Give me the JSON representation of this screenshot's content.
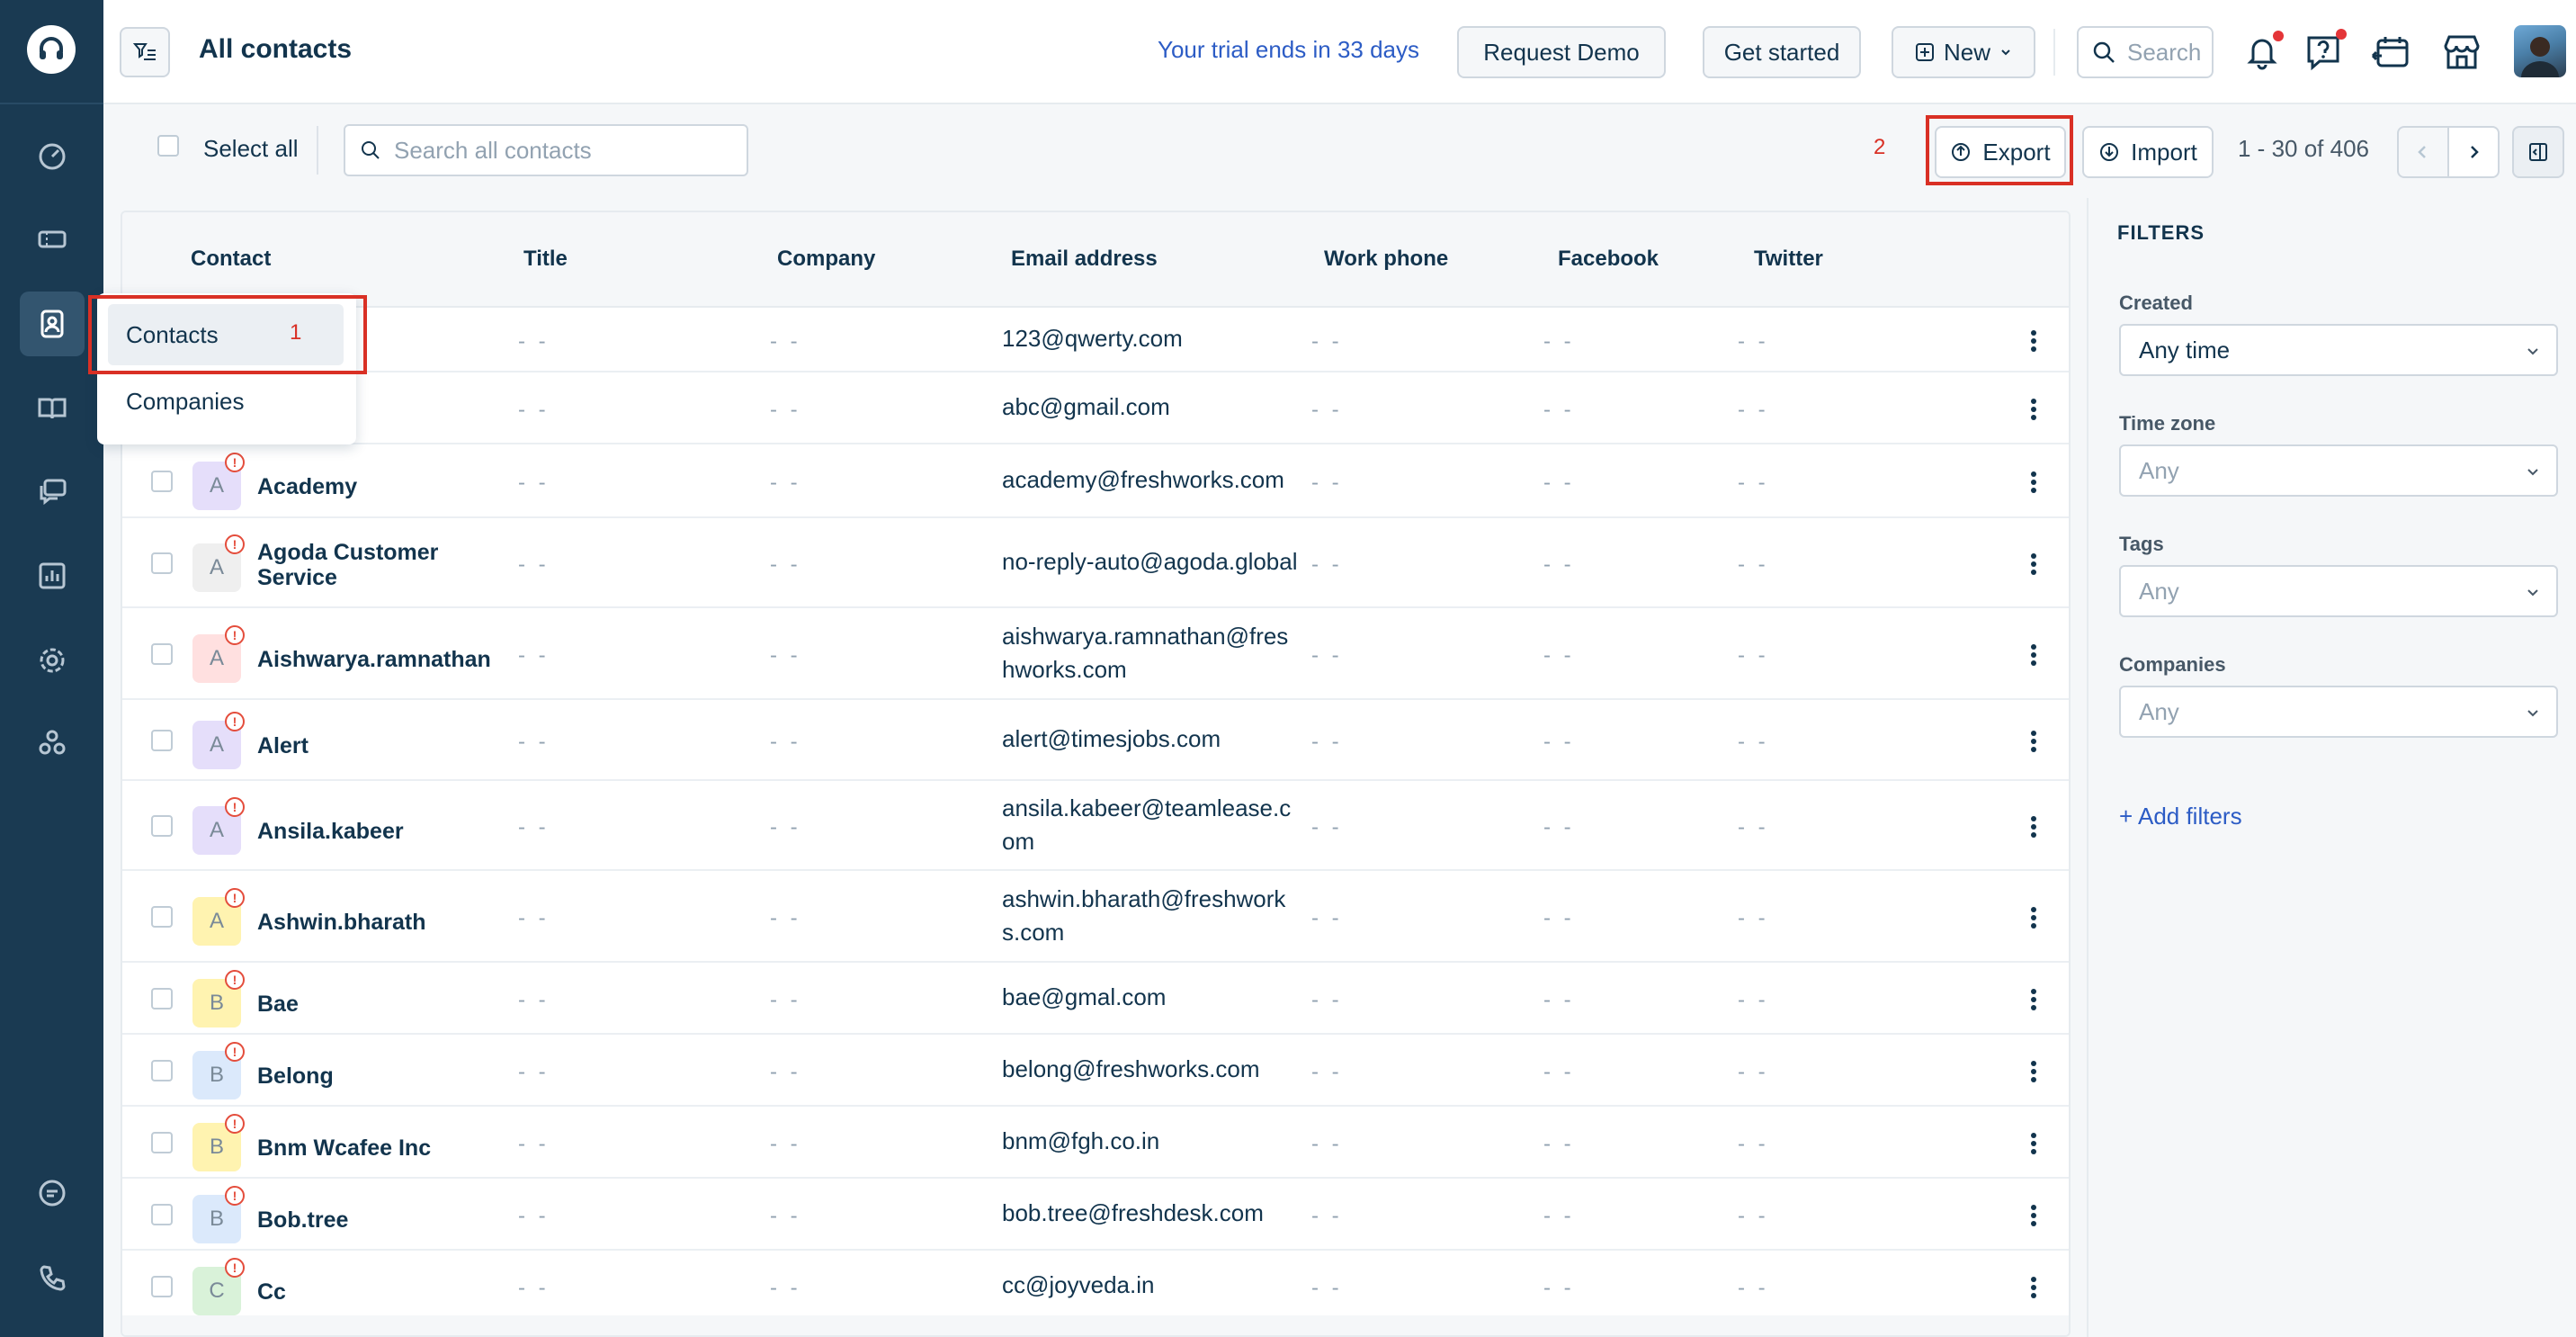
{
  "header": {
    "title": "All contacts",
    "trial_text": "Your trial ends in 33 days",
    "request_demo": "Request Demo",
    "get_started": "Get started",
    "new_label": "New",
    "search_placeholder": "Search"
  },
  "toolbar": {
    "select_all": "Select all",
    "search_placeholder": "Search all contacts",
    "export_label": "Export",
    "import_label": "Import",
    "pagination": "1 - 30 of 406",
    "callout_export": "2"
  },
  "dropdown": {
    "items": [
      "Contacts",
      "Companies"
    ],
    "callout": "1"
  },
  "table": {
    "columns": [
      "Contact",
      "Title",
      "Company",
      "Email address",
      "Work phone",
      "Facebook",
      "Twitter"
    ],
    "empty": "- -",
    "rows": [
      {
        "initial": "",
        "name": "",
        "email": "123@qwerty.com",
        "color": "#ffffff"
      },
      {
        "initial": "",
        "name": "",
        "email": "abc@gmail.com",
        "color": "#ffffff"
      },
      {
        "initial": "A",
        "name": "Academy",
        "email": "academy@freshworks.com",
        "color": "#e5defa"
      },
      {
        "initial": "A",
        "name": "Agoda Customer Service",
        "email": "no-reply-auto@agoda.global",
        "color": "#efefef"
      },
      {
        "initial": "A",
        "name": "Aishwarya.ramnathan",
        "email": "aishwarya.ramnathan@freshworks.com",
        "color": "#ffe0e0"
      },
      {
        "initial": "A",
        "name": "Alert",
        "email": "alert@timesjobs.com",
        "color": "#e5defa"
      },
      {
        "initial": "A",
        "name": "Ansila.kabeer",
        "email": "ansila.kabeer@teamlease.com",
        "color": "#e5defa"
      },
      {
        "initial": "A",
        "name": "Ashwin.bharath",
        "email": "ashwin.bharath@freshworks.com",
        "color": "#fff3b0"
      },
      {
        "initial": "B",
        "name": "Bae",
        "email": "bae@gmal.com",
        "color": "#fff3b0"
      },
      {
        "initial": "B",
        "name": "Belong",
        "email": "belong@freshworks.com",
        "color": "#dbe9fb"
      },
      {
        "initial": "B",
        "name": "Bnm Wcafee Inc",
        "email": "bnm@fgh.co.in",
        "color": "#fff3b0"
      },
      {
        "initial": "B",
        "name": "Bob.tree",
        "email": "bob.tree@freshdesk.com",
        "color": "#dbe9fb"
      },
      {
        "initial": "C",
        "name": "Cc",
        "email": "cc@joyveda.in",
        "color": "#d9f2d9"
      }
    ]
  },
  "filters": {
    "title": "FILTERS",
    "created_label": "Created",
    "created_value": "Any time",
    "timezone_label": "Time zone",
    "timezone_value": "Any",
    "tags_label": "Tags",
    "tags_value": "Any",
    "companies_label": "Companies",
    "companies_value": "Any",
    "add_filters": "+ Add filters"
  },
  "colors": {
    "sidebar": "#1a3a52",
    "accent_link": "#2c5cc5",
    "highlight": "#d93025"
  }
}
